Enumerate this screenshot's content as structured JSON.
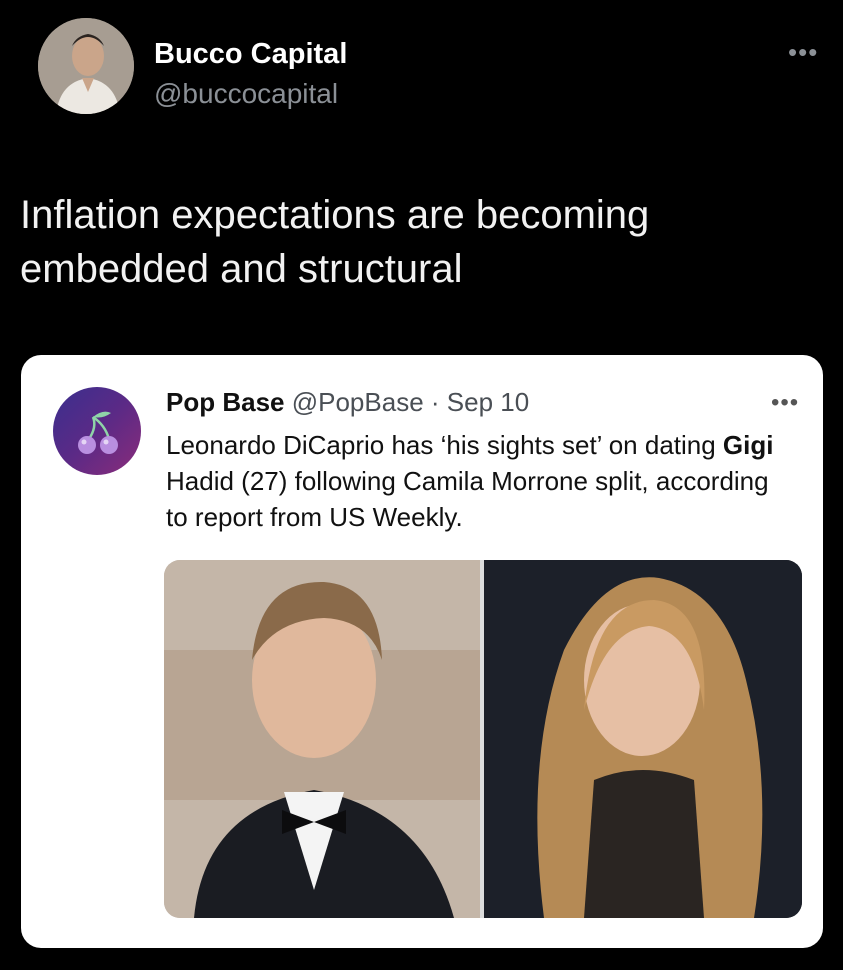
{
  "tweet": {
    "author_name": "Bucco Capital",
    "author_handle": "@buccocapital",
    "text": "Inflation expectations are becoming\nembedded and structural",
    "more_icon": "more-horizontal-icon"
  },
  "quote": {
    "author_name": "Pop Base",
    "author_handle": "@PopBase",
    "separator": "·",
    "date": "Sep 10",
    "text_part1": "Leonardo DiCaprio has ‘his sights set’ on dating ",
    "text_bold": "Gigi",
    "text_part2": " Hadid (27) following Camila Morrone split, according to report from US Weekly.",
    "more_icon": "more-horizontal-icon",
    "avatar_icon": "cherry-icon"
  },
  "colors": {
    "background": "#000000",
    "card": "#ffffff",
    "secondary_text": "#8b9096"
  }
}
